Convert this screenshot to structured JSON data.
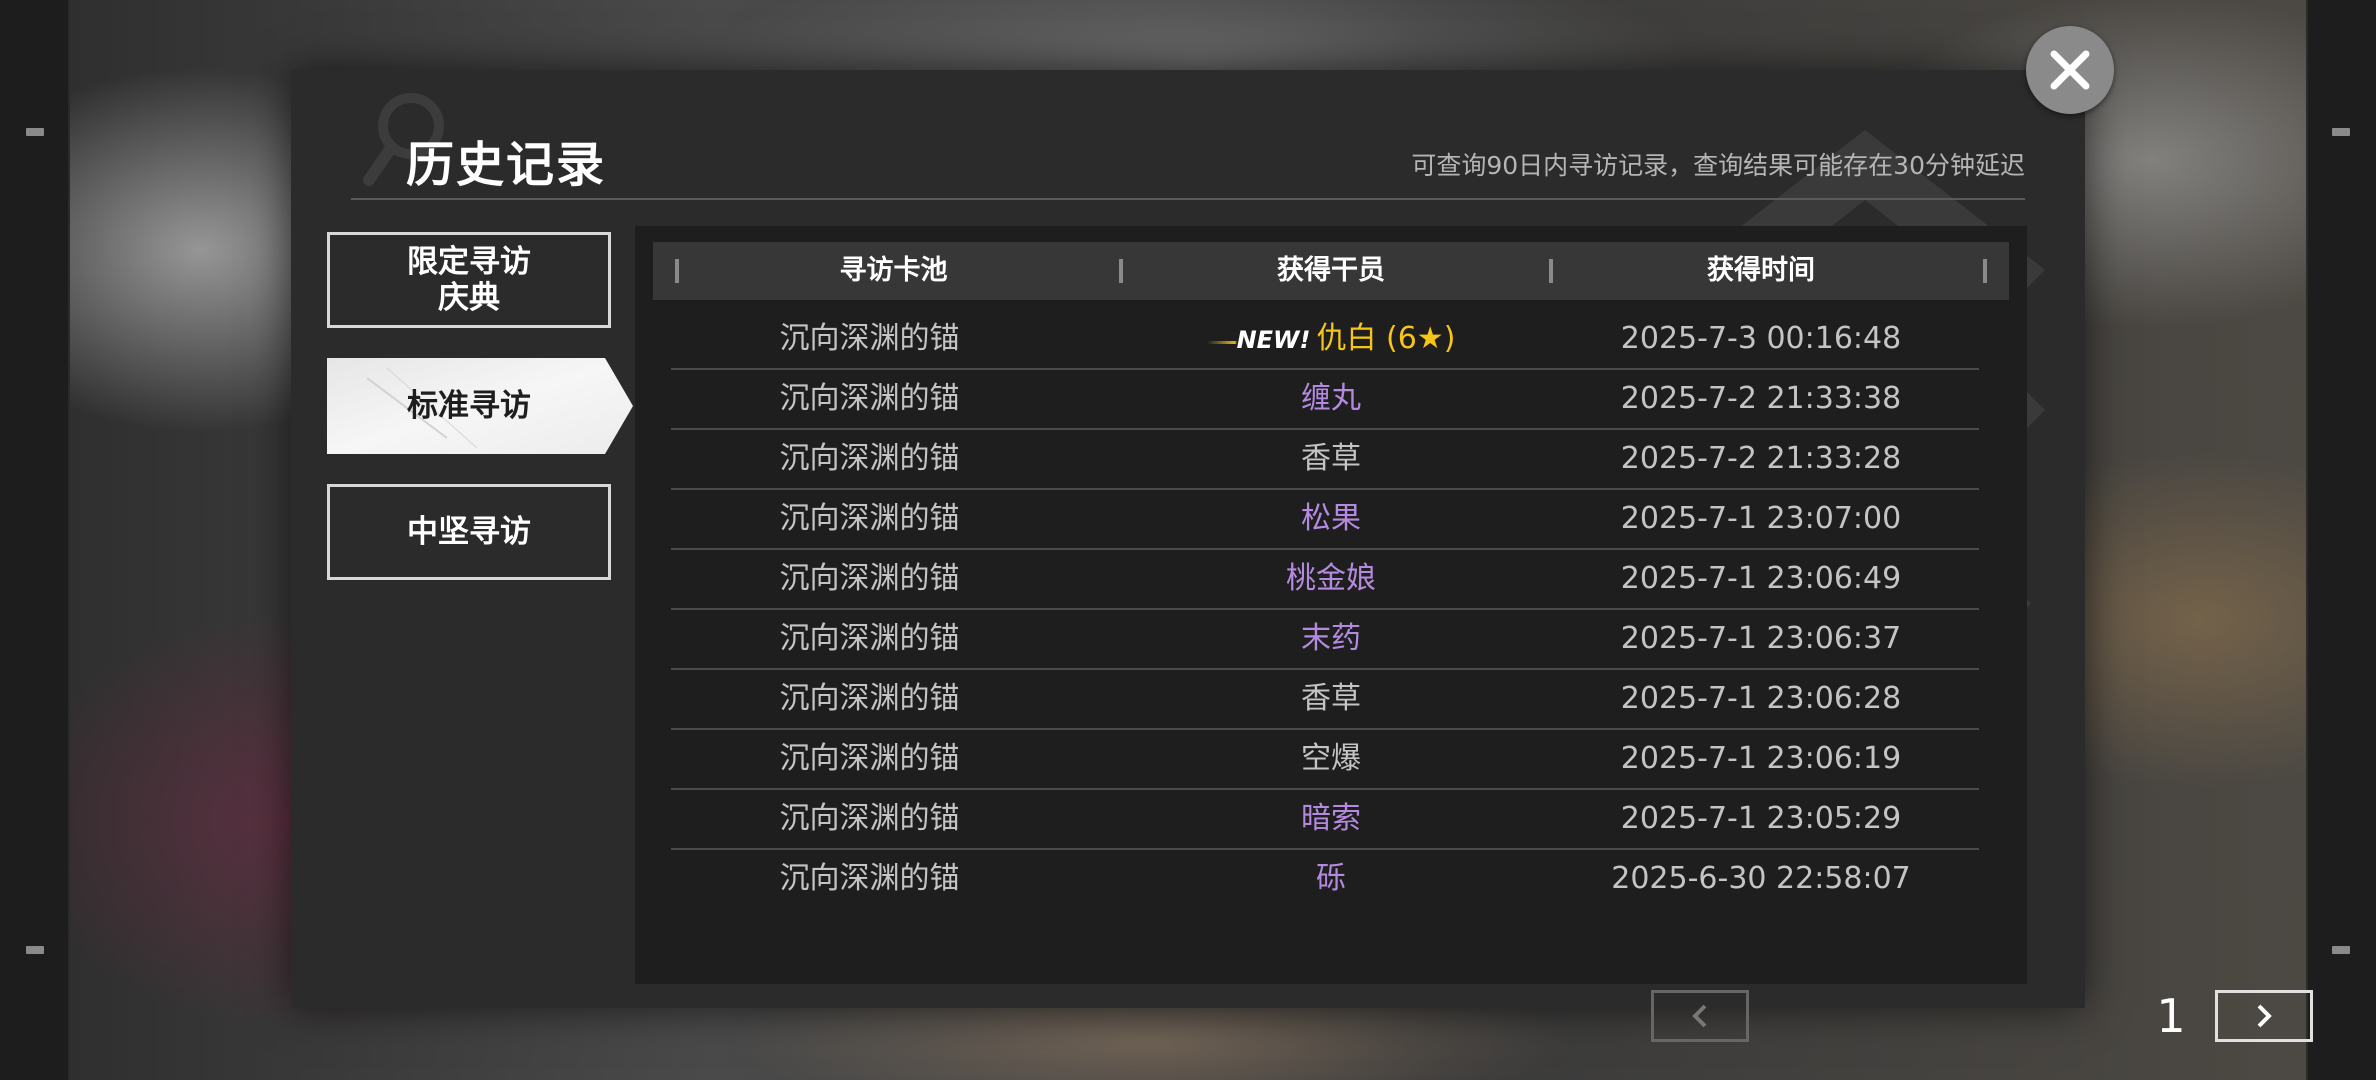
{
  "modal": {
    "title": "历史记录",
    "subtitle": "可查询90日内寻访记录，查询结果可能存在30分钟延迟"
  },
  "tabs": [
    {
      "label": "限定寻访\n庆典",
      "active": false
    },
    {
      "label": "标准寻访",
      "active": true
    },
    {
      "label": "中坚寻访",
      "active": false
    }
  ],
  "table": {
    "headers": [
      "寻访卡池",
      "获得干员",
      "获得时间"
    ],
    "rows": [
      {
        "pool": "沉向深渊的锚",
        "badge": "NEW!",
        "operator": "仇白 (6★)",
        "rarity": "6",
        "time": "2025-7-3 00:16:48"
      },
      {
        "pool": "沉向深渊的锚",
        "operator": "缠丸",
        "rarity": "4",
        "time": "2025-7-2 21:33:38"
      },
      {
        "pool": "沉向深渊的锚",
        "operator": "香草",
        "rarity": "3",
        "time": "2025-7-2 21:33:28"
      },
      {
        "pool": "沉向深渊的锚",
        "operator": "松果",
        "rarity": "4",
        "time": "2025-7-1 23:07:00"
      },
      {
        "pool": "沉向深渊的锚",
        "operator": "桃金娘",
        "rarity": "4",
        "time": "2025-7-1 23:06:49"
      },
      {
        "pool": "沉向深渊的锚",
        "operator": "末药",
        "rarity": "4",
        "time": "2025-7-1 23:06:37"
      },
      {
        "pool": "沉向深渊的锚",
        "operator": "香草",
        "rarity": "3",
        "time": "2025-7-1 23:06:28"
      },
      {
        "pool": "沉向深渊的锚",
        "operator": "空爆",
        "rarity": "3",
        "time": "2025-7-1 23:06:19"
      },
      {
        "pool": "沉向深渊的锚",
        "operator": "暗索",
        "rarity": "4",
        "time": "2025-7-1 23:05:29"
      },
      {
        "pool": "沉向深渊的锚",
        "operator": "砾",
        "rarity": "4",
        "time": "2025-6-30 22:58:07"
      }
    ]
  },
  "pagination": {
    "current_page": "1",
    "prev_icon": "chevron-left-icon",
    "next_icon": "chevron-right-icon"
  },
  "close_icon": "close-icon",
  "colors": {
    "rarity_6": "#f5c518",
    "rarity_4": "#b48ae0",
    "rarity_3": "#c4c4c4"
  }
}
